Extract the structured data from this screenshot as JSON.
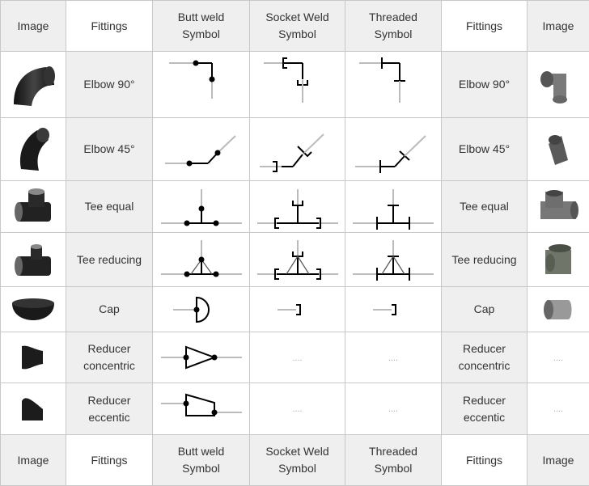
{
  "header": [
    "Image",
    "Fittings",
    "Butt weld\nSymbol",
    "Socket Weld\nSymbol",
    "Threaded\nSymbol",
    "Fittings",
    "Image"
  ],
  "header_lines": [
    [
      "Image"
    ],
    [
      "Fittings"
    ],
    [
      "Butt weld",
      "Symbol"
    ],
    [
      "Socket Weld",
      "Symbol"
    ],
    [
      "Threaded",
      "Symbol"
    ],
    [
      "Fittings"
    ],
    [
      "Image"
    ]
  ],
  "rows": [
    {
      "name": [
        "Elbow 90°"
      ],
      "left_image": "black-elbow-90",
      "right_image": "forged-elbow-90",
      "butt": "elbow90",
      "socket": "elbow90",
      "threaded": "elbow90"
    },
    {
      "name": [
        "Elbow 45°"
      ],
      "left_image": "black-elbow-45",
      "right_image": "forged-elbow-45",
      "butt": "elbow45",
      "socket": "elbow45",
      "threaded": "elbow45"
    },
    {
      "name": [
        "Tee equal"
      ],
      "left_image": "black-tee-equal",
      "right_image": "forged-tee-equal",
      "butt": "tee",
      "socket": "tee",
      "threaded": "tee"
    },
    {
      "name": [
        "Tee reducing"
      ],
      "left_image": "black-tee-reducing",
      "right_image": "forged-tee-reducing",
      "butt": "teered",
      "socket": "teered",
      "threaded": "teered"
    },
    {
      "name": [
        "Cap"
      ],
      "left_image": "black-cap",
      "right_image": "forged-cap",
      "butt": "cap",
      "socket": "cap",
      "threaded": "cap"
    },
    {
      "name": [
        "Reducer",
        "concentric"
      ],
      "left_image": "black-reducer-concentric",
      "right_image": null,
      "butt": "redcon",
      "socket": null,
      "threaded": null
    },
    {
      "name": [
        "Reducer",
        "eccentic"
      ],
      "left_image": "black-reducer-eccentric",
      "right_image": null,
      "butt": "redecc",
      "socket": null,
      "threaded": null
    }
  ],
  "placeholder": "....",
  "colors": {
    "line": "#000000",
    "pipe": "#bbbbbb",
    "header_gray": "#efefef",
    "border": "#c8c8c8"
  }
}
